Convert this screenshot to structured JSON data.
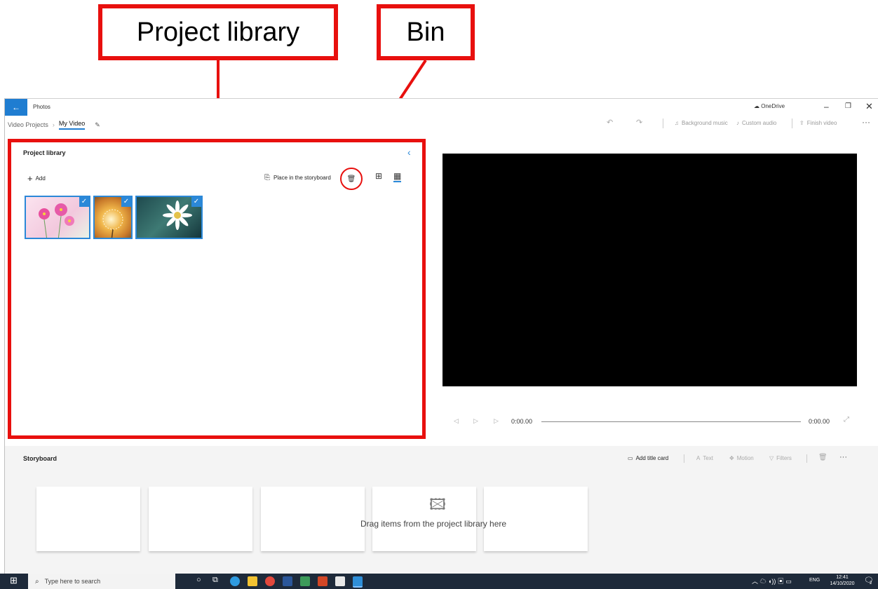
{
  "annotations": {
    "project_library_label": "Project library",
    "bin_label": "Bin"
  },
  "window": {
    "app_title": "Photos",
    "onedrive_label": "OneDrive",
    "breadcrumb": [
      "Video Projects",
      "My Video"
    ],
    "toolbar": {
      "background_music": "Background music",
      "custom_audio": "Custom audio",
      "finish_video": "Finish video"
    }
  },
  "library": {
    "title": "Project library",
    "add_label": "Add",
    "place_label": "Place in the storyboard",
    "thumbnails": [
      {
        "name": "pink-flowers",
        "color": "#f2c8dd"
      },
      {
        "name": "dandelion",
        "color": "#e8a03a"
      },
      {
        "name": "daisy",
        "color": "#3b6a66"
      }
    ]
  },
  "player": {
    "time_current": "0:00.00",
    "time_total": "0:00.00"
  },
  "storyboard": {
    "title": "Storyboard",
    "add_title_card": "Add title card",
    "text_label": "Text",
    "motion_label": "Motion",
    "filters_label": "Filters",
    "empty_message": "Drag items from the project library here"
  },
  "taskbar": {
    "search_placeholder": "Type here to search",
    "language": "ENG",
    "time": "12:41",
    "date": "14/10/2020",
    "notification_count": "2"
  },
  "colors": {
    "accent": "#1f7dd1",
    "highlight_red": "#e8100e",
    "taskbar": "#1e2a3a"
  }
}
